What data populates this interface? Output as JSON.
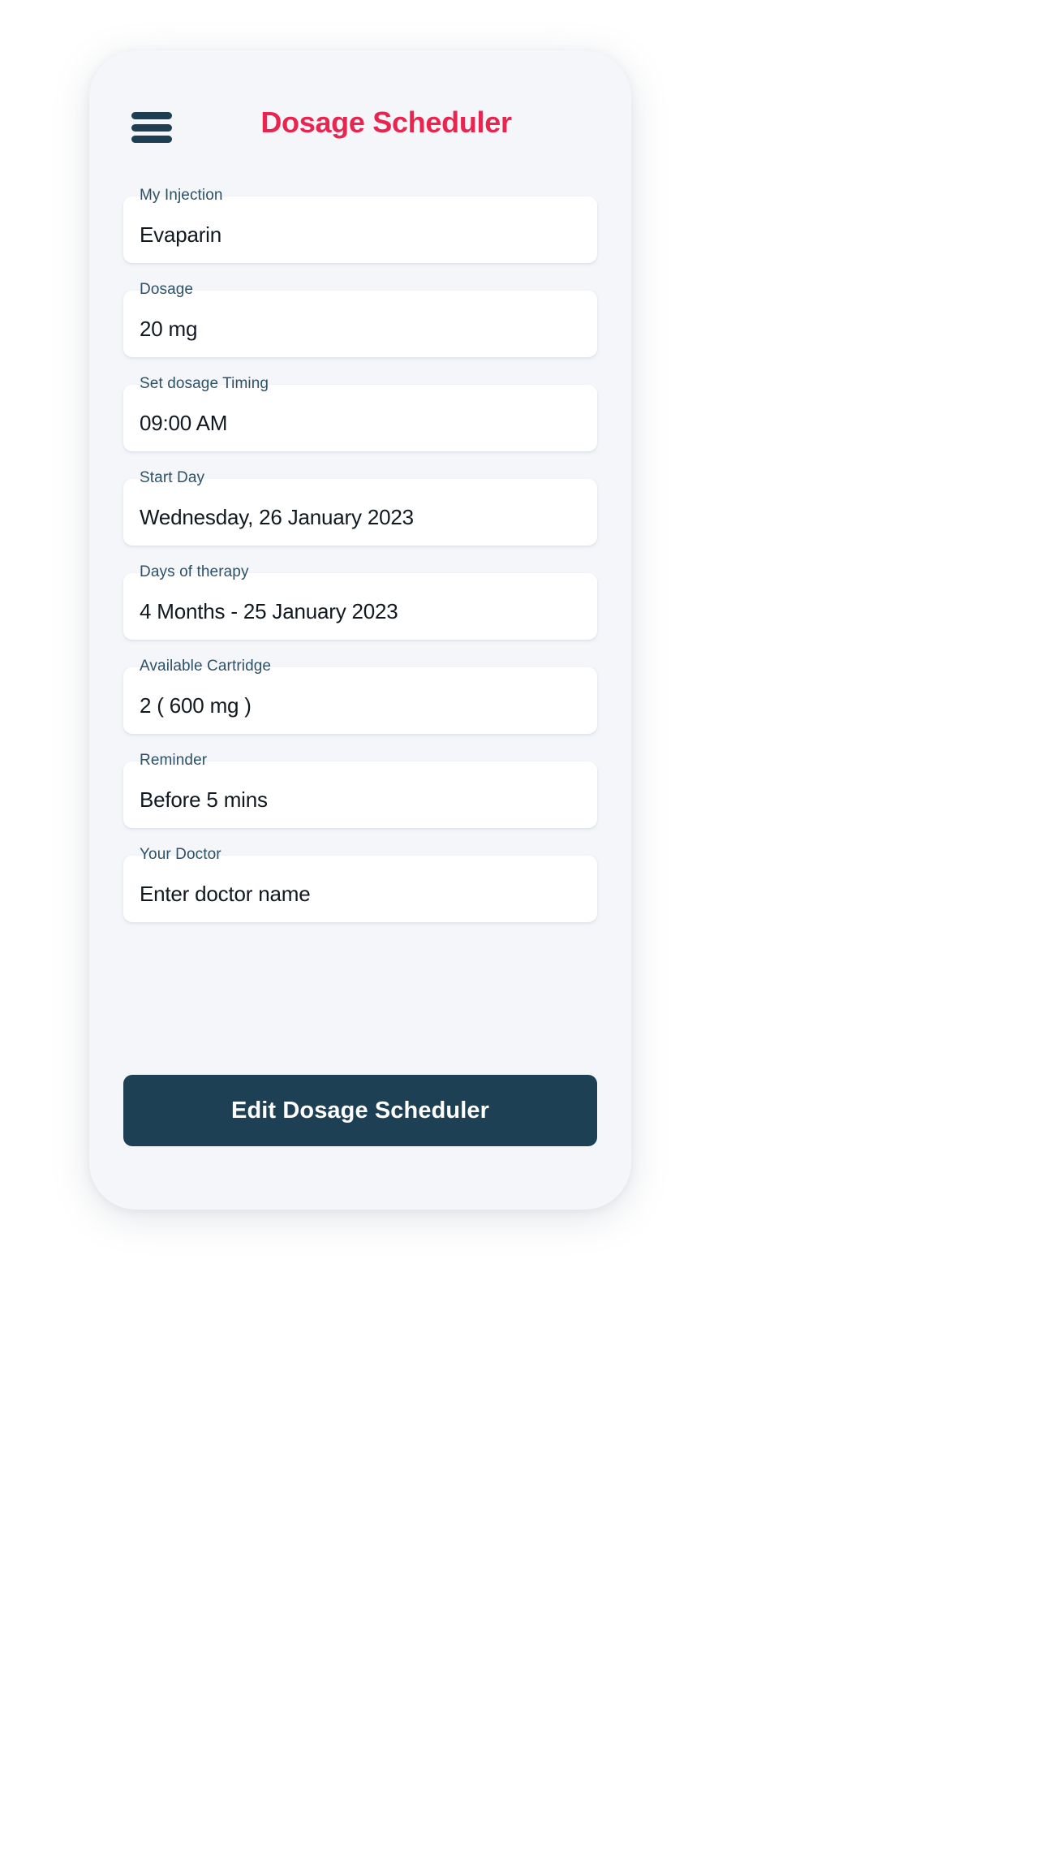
{
  "app": {
    "title": "Dosage Scheduler",
    "menu_icon": "hamburger-menu-icon"
  },
  "theme": {
    "accent": "#e8244f",
    "label_color": "#2f5166",
    "value_color": "#111820",
    "button_bg": "#1d4054",
    "screen_bg": "#f4f6fa",
    "card_bg": "#ffffff"
  },
  "form": {
    "fields": [
      {
        "label": "My Injection",
        "value": "Evaparin",
        "name": "my-injection"
      },
      {
        "label": "Dosage",
        "value": "20 mg",
        "name": "dosage"
      },
      {
        "label": "Set dosage Timing",
        "value": "09:00 AM",
        "name": "set-dosage-timing"
      },
      {
        "label": "Start Day",
        "value": "Wednesday, 26 January 2023",
        "name": "start-day"
      },
      {
        "label": "Days of therapy",
        "value": "4 Months - 25 January 2023",
        "name": "days-of-therapy"
      },
      {
        "label": "Available Cartridge",
        "value": "2  ( 600 mg )",
        "name": "available-cartridge"
      },
      {
        "label": "Reminder",
        "value": "Before 5 mins",
        "name": "reminder"
      },
      {
        "label": "Your Doctor",
        "value": "Enter doctor name",
        "name": "your-doctor",
        "is_placeholder": true
      }
    ]
  },
  "cta": {
    "label": "Edit Dosage Scheduler"
  }
}
